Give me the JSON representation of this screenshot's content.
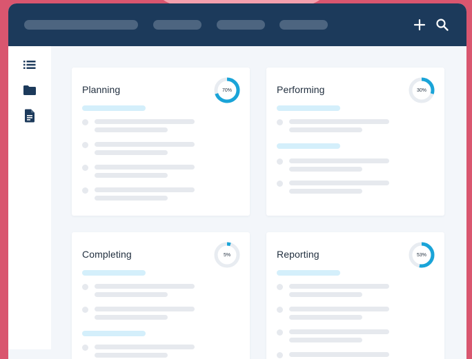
{
  "colors": {
    "background": "#d9566f",
    "header": "#1c3a5b",
    "accent": "#1aa4d8",
    "track": "#e8ecf1"
  },
  "header": {
    "nav_placeholders": 4,
    "actions": [
      {
        "icon": "plus-icon"
      },
      {
        "icon": "search-icon"
      }
    ]
  },
  "sidebar": {
    "items": [
      {
        "icon": "list-icon"
      },
      {
        "icon": "folder-icon"
      },
      {
        "icon": "document-icon"
      }
    ]
  },
  "cards": [
    {
      "title": "Planning",
      "progress_label": "70%",
      "progress": 0.7
    },
    {
      "title": "Performing",
      "progress_label": "30%",
      "progress": 0.3
    },
    {
      "title": "Completing",
      "progress_label": "5%",
      "progress": 0.05
    },
    {
      "title": "Reporting",
      "progress_label": "53%",
      "progress": 0.53
    }
  ]
}
